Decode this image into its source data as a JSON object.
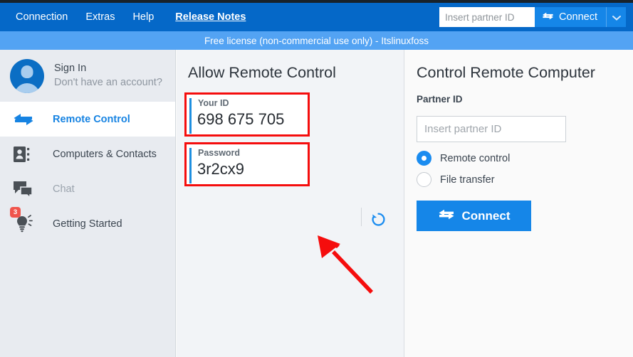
{
  "window": {
    "menu": [
      {
        "label": "Connection",
        "name": "menu-connection"
      },
      {
        "label": "Extras",
        "name": "menu-extras"
      },
      {
        "label": "Help",
        "name": "menu-help"
      },
      {
        "label": "Release Notes",
        "name": "menu-release-notes"
      }
    ],
    "toolbar": {
      "partner_id_value": "",
      "partner_id_placeholder": "Insert partner ID",
      "connect_label": "Connect",
      "connect_icon": "double-arrow-icon",
      "dropdown_icon": "chevron-down-icon"
    },
    "license_banner": "Free license (non-commercial use only) - Itslinuxfoss"
  },
  "sidebar": {
    "account": {
      "title": "Sign In",
      "subtitle": "Don't have an account?",
      "avatar_icon": "user-avatar-icon"
    },
    "items": [
      {
        "label": "Remote Control",
        "icon": "double-arrow-icon",
        "state": "active",
        "badge": ""
      },
      {
        "label": "Computers & Contacts",
        "icon": "contacts-book-icon",
        "state": "normal",
        "badge": ""
      },
      {
        "label": "Chat",
        "icon": "chat-bubble-icon",
        "state": "disabled",
        "badge": ""
      },
      {
        "label": "Getting Started",
        "icon": "lightbulb-icon",
        "state": "normal",
        "badge": "3"
      }
    ]
  },
  "allow_remote_control": {
    "title": "Allow Remote Control",
    "your_id_label": "Your ID",
    "your_id_value": "698 675 705",
    "password_label": "Password",
    "password_value": "3r2cx9",
    "refresh_icon": "refresh-password-icon"
  },
  "control_remote_computer": {
    "title": "Control Remote Computer",
    "partner_id_label": "Partner ID",
    "partner_id_value": "",
    "partner_id_placeholder": "Insert partner ID",
    "options": [
      {
        "label": "Remote control",
        "selected": true
      },
      {
        "label": "File transfer",
        "selected": false
      }
    ],
    "connect_label": "Connect",
    "connect_icon": "double-arrow-icon"
  },
  "annotations": {
    "highlight_color": "#f50d0d",
    "arrow_color": "#f50d0d",
    "highlighted_fields": [
      "Your ID",
      "Password"
    ],
    "arrow_points_to": "Password"
  },
  "colors": {
    "menubar": "#0568c8",
    "license_bar": "#53a3f3",
    "accent": "#1586e8",
    "sidebar_bg": "#e8ebf0",
    "badge": "#f0544c"
  }
}
